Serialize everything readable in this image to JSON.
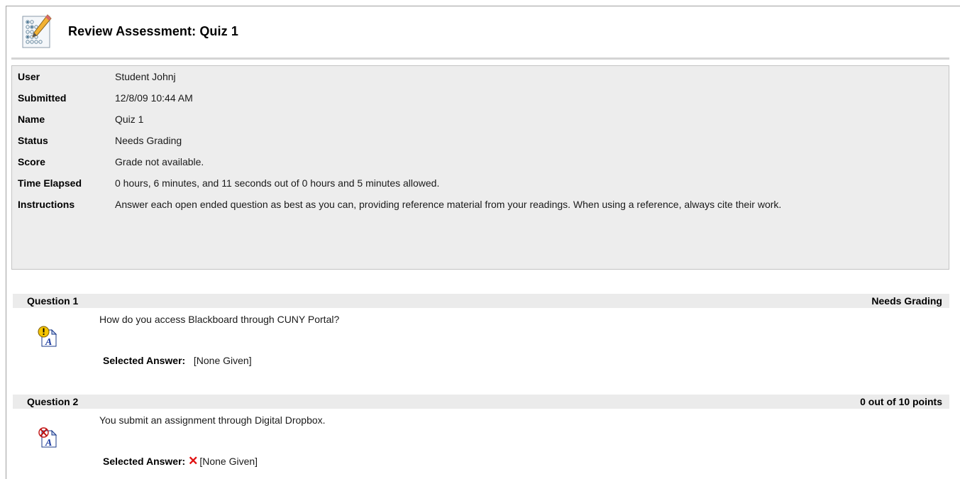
{
  "page": {
    "title": "Review Assessment: Quiz 1"
  },
  "info": [
    {
      "label": "User",
      "value": "Student Johnj"
    },
    {
      "label": "Submitted",
      "value": "12/8/09 10:44 AM"
    },
    {
      "label": "Name",
      "value": "Quiz 1"
    },
    {
      "label": "Status",
      "value": "Needs Grading"
    },
    {
      "label": "Score",
      "value": "Grade not available."
    },
    {
      "label": "Time Elapsed",
      "value": "0 hours, 6 minutes, and 11 seconds out of 0 hours and 5 minutes allowed."
    },
    {
      "label": "Instructions",
      "value": "Answer each open ended question as best as you can, providing reference material from your readings.  When using a reference, always cite their work."
    }
  ],
  "questions": [
    {
      "label": "Question 1",
      "status": "Needs Grading",
      "text": "How do you access Blackboard through CUNY Portal?",
      "answer_label": "Selected Answer:",
      "answer": "[None Given]",
      "icon": "needs-grading-icon"
    },
    {
      "label": "Question 2",
      "status": "0 out of 10 points",
      "text": "You submit an assignment through Digital Dropbox.",
      "answer_label": "Selected Answer:",
      "answer_mark": "✕",
      "answer": "[None Given]",
      "icon": "incorrect-icon"
    }
  ],
  "colors": {
    "info_bg": "#ededed",
    "bar_bg": "#ebebeb",
    "incorrect": "#e01010",
    "warning": "#f5c400"
  }
}
